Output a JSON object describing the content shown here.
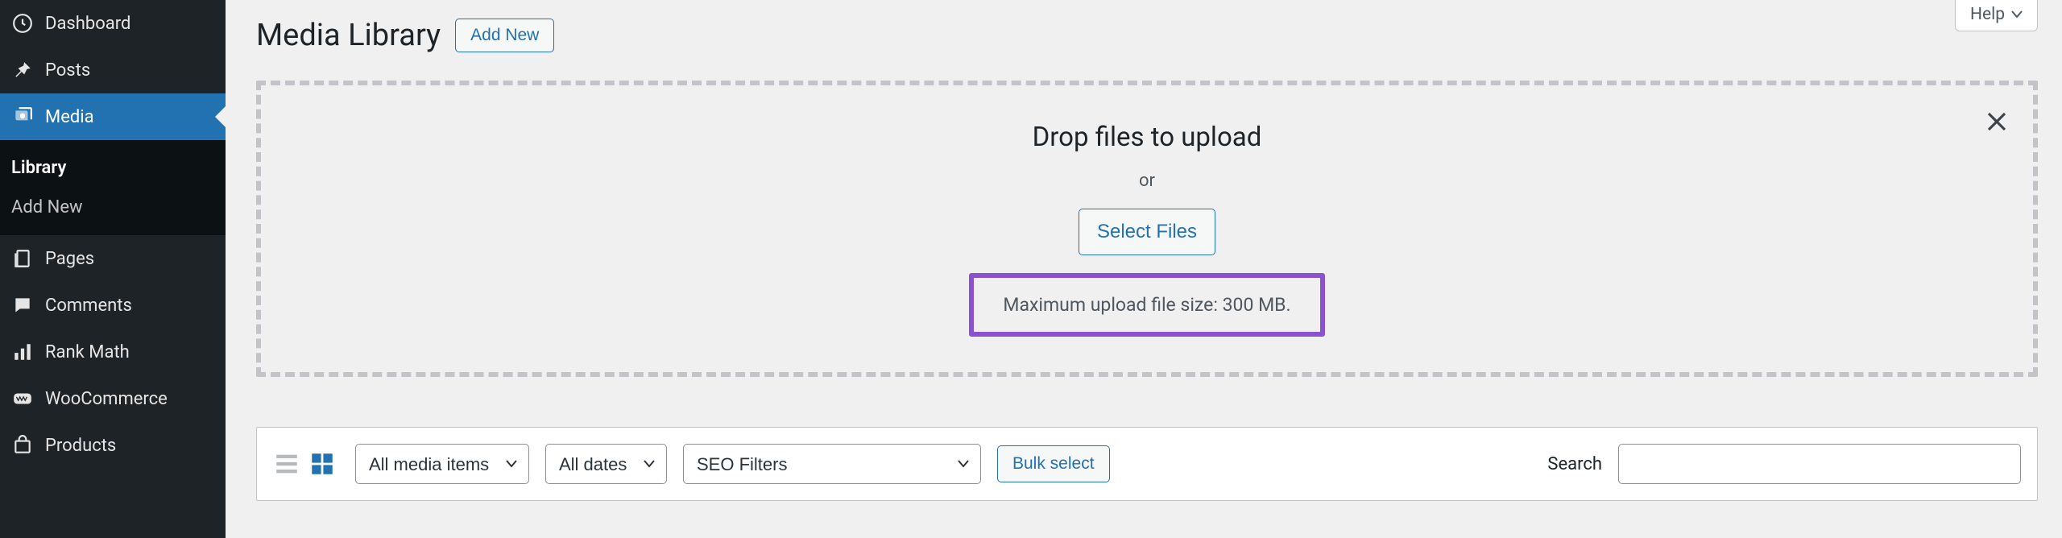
{
  "sidebar": {
    "items": [
      {
        "label": "Dashboard"
      },
      {
        "label": "Posts"
      },
      {
        "label": "Media"
      },
      {
        "label": "Pages"
      },
      {
        "label": "Comments"
      },
      {
        "label": "Rank Math"
      },
      {
        "label": "WooCommerce"
      },
      {
        "label": "Products"
      }
    ],
    "submenu": {
      "library": "Library",
      "add_new": "Add New"
    }
  },
  "header": {
    "page_title": "Media Library",
    "add_new_label": "Add New"
  },
  "help_tab": "Help",
  "dropzone": {
    "heading": "Drop files to upload",
    "or": "or",
    "select_files_label": "Select Files",
    "max_size_note": "Maximum upload file size: 300 MB."
  },
  "filters": {
    "media_types_selected": "All media items",
    "dates_selected": "All dates",
    "seo_selected": "SEO Filters",
    "bulk_select_label": "Bulk select",
    "search_label": "Search"
  }
}
